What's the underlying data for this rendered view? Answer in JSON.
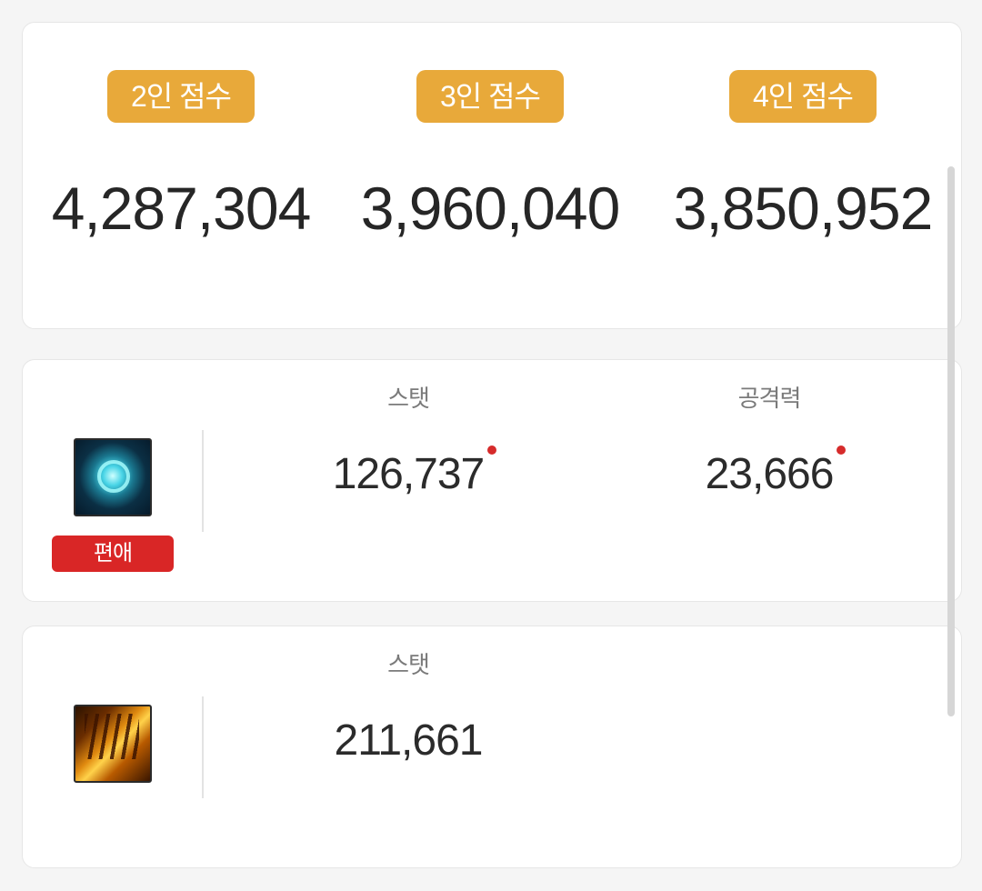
{
  "scores": [
    {
      "label": "2인 점수",
      "value": "4,287,304"
    },
    {
      "label": "3인 점수",
      "value": "3,960,040"
    },
    {
      "label": "4인 점수",
      "value": "3,850,952"
    }
  ],
  "buffs": [
    {
      "icon": "rose-buff-icon",
      "tag": "편애",
      "stats": [
        {
          "label": "스탯",
          "value": "126,737",
          "changed": true
        },
        {
          "label": "공격력",
          "value": "23,666",
          "changed": true
        }
      ]
    },
    {
      "icon": "fire-buff-icon",
      "stats": [
        {
          "label": "스탯",
          "value": "211,661"
        }
      ]
    }
  ],
  "colors": {
    "badge": "#e8a93a",
    "tag": "#d92626",
    "dot": "#d62b2b"
  }
}
